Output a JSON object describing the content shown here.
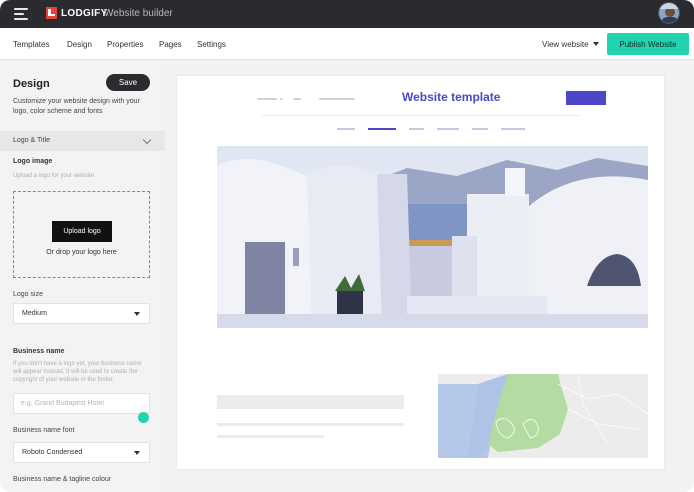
{
  "app": {
    "brand": "LODGIFY",
    "title": "Website builder"
  },
  "nav": {
    "items": [
      "Templates",
      "Design",
      "Properties",
      "Pages",
      "Settings"
    ],
    "view_website": "View website",
    "publish": "Publish Website"
  },
  "sidebar": {
    "title": "Design",
    "save": "Save",
    "description": "Customize your website design with your logo, color scheme and fonts",
    "section": "Logo & Title",
    "logo_image_label": "Logo image",
    "logo_image_hint": "Upload a logo for your website",
    "upload_button": "Upload logo",
    "drop_text": "Or drop your logo here",
    "logo_size_label": "Logo size",
    "logo_size_value": "Medium",
    "business_name_label": "Business name",
    "business_name_hint": "If you don't have a logo yet, your business name will appear instead. It will be used to create the copyright of your website in the footer.",
    "business_name_placeholder": "e.g. Grand Budapest Hotel",
    "font_label": "Business name font",
    "font_value": "Roboto Condensed",
    "colour_label": "Business name & tagline colour"
  },
  "preview": {
    "title": "Website template"
  },
  "colors": {
    "topbar": "#2a2b2f",
    "accent": "#22d3b0",
    "template_accent": "#4c47c9",
    "brand_red": "#e8413c"
  },
  "icons": [
    "menu-icon",
    "lodgify-logo-icon",
    "caret-down-icon",
    "chevron-down-icon"
  ]
}
